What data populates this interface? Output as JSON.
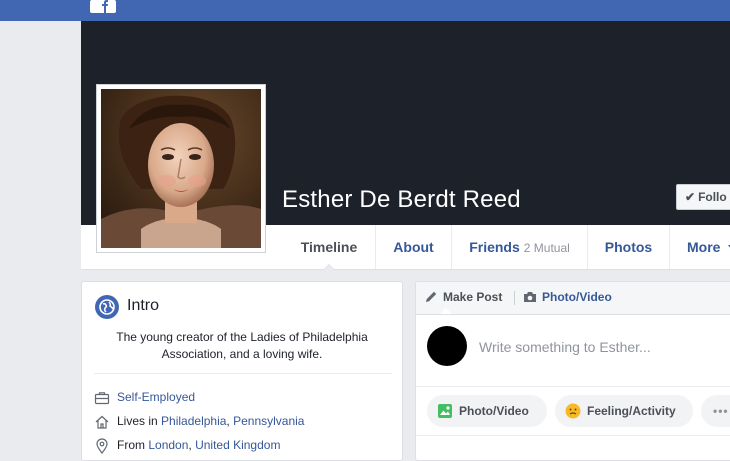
{
  "profile": {
    "name": "Esther De Berdt Reed",
    "follow_label": "Follo"
  },
  "tabs": [
    {
      "label": "Timeline",
      "active": true
    },
    {
      "label": "About"
    },
    {
      "label": "Friends",
      "sub": "2 Mutual"
    },
    {
      "label": "Photos"
    },
    {
      "label": "More"
    }
  ],
  "intro": {
    "title": "Intro",
    "bio": "The young creator of the Ladies of Philadelphia Association, and a loving wife.",
    "work": "Self-Employed",
    "lives_prefix": "Lives in",
    "lives_city": "Philadelphia",
    "lives_region": "Pennsylvania",
    "from_prefix": "From",
    "from_city": "London",
    "from_region": "United Kingdom"
  },
  "composer": {
    "make_post": "Make Post",
    "photo_video_tab": "Photo/Video",
    "placeholder": "Write something to Esther...",
    "photo_video_btn": "Photo/Video",
    "feeling_btn": "Feeling/Activity",
    "more": "•••"
  },
  "colors": {
    "brand": "#4267b2",
    "link": "#365899",
    "cover": "#1d2129"
  },
  "icons": [
    "facebook-logo-icon",
    "check-icon",
    "chevron-down-icon",
    "globe-icon",
    "briefcase-icon",
    "home-icon",
    "location-pin-icon",
    "pencil-icon",
    "camera-icon",
    "photo-icon",
    "smiley-icon"
  ]
}
